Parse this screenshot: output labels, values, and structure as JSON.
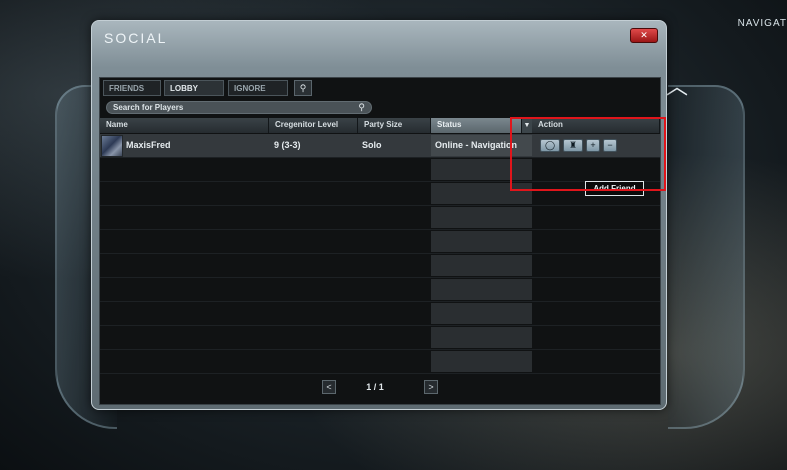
{
  "window": {
    "title": "SOCIAL",
    "corner_label": "NAVIGAT"
  },
  "tabs": [
    {
      "label": "FRIENDS",
      "active": false
    },
    {
      "label": "LOBBY",
      "active": true
    },
    {
      "label": "IGNORE",
      "active": false
    }
  ],
  "search": {
    "placeholder": "Search for Players"
  },
  "table": {
    "columns": [
      "Name",
      "Cregenitor Level",
      "Party Size",
      "Status",
      "Action"
    ],
    "rows": [
      {
        "name": "MaxisFred",
        "level": "9 (3-3)",
        "party_size": "Solo",
        "status": "Online - Navigation",
        "actions": [
          "chat-icon",
          "party-invite-icon",
          "plus-icon",
          "minus-icon"
        ]
      }
    ]
  },
  "popup": {
    "add_friend_label": "Add Friend"
  },
  "pagination": {
    "text": "1 / 1",
    "prev": "<",
    "next": ">"
  },
  "colors": {
    "highlight": "#e0151b",
    "close_button": "#c42a2a"
  }
}
